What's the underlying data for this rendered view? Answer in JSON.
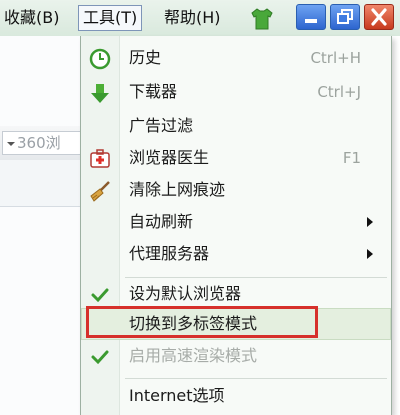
{
  "menubar": {
    "favorites_label": "收藏(B)",
    "tools_label": "工具(T)",
    "help_label": "帮助(H)",
    "skin_icon": "shirt-icon",
    "minimize_icon": "minimize-icon",
    "restore_icon": "restore-icon",
    "close_icon": "close-icon"
  },
  "background": {
    "address_text": "360浏"
  },
  "menu": {
    "items": [
      {
        "label": "历史",
        "shortcut": "Ctrl+H",
        "icon": "clock-icon"
      },
      {
        "label": "下载器",
        "shortcut": "Ctrl+J",
        "icon": "download-arrow-icon"
      },
      {
        "label": "广告过滤"
      },
      {
        "label": "浏览器医生",
        "shortcut": "F1",
        "icon": "medical-kit-icon"
      },
      {
        "label": "清除上网痕迹",
        "icon": "broom-icon"
      },
      {
        "label": "自动刷新",
        "submenu": true
      },
      {
        "label": "代理服务器",
        "submenu": true
      },
      {
        "label": "设为默认浏览器",
        "icon": "check-icon"
      },
      {
        "label": "切换到多标签模式",
        "state": "hovered"
      },
      {
        "label": "启用高速渲染模式",
        "icon": "check-icon",
        "state": "disabled"
      },
      {
        "label": "Internet选项"
      }
    ]
  },
  "colors": {
    "highlight_border": "#d6302b",
    "check_green": "#3a9a2f",
    "window_button_blue": "#2d65cf",
    "close_button_red": "#c73a1e"
  }
}
